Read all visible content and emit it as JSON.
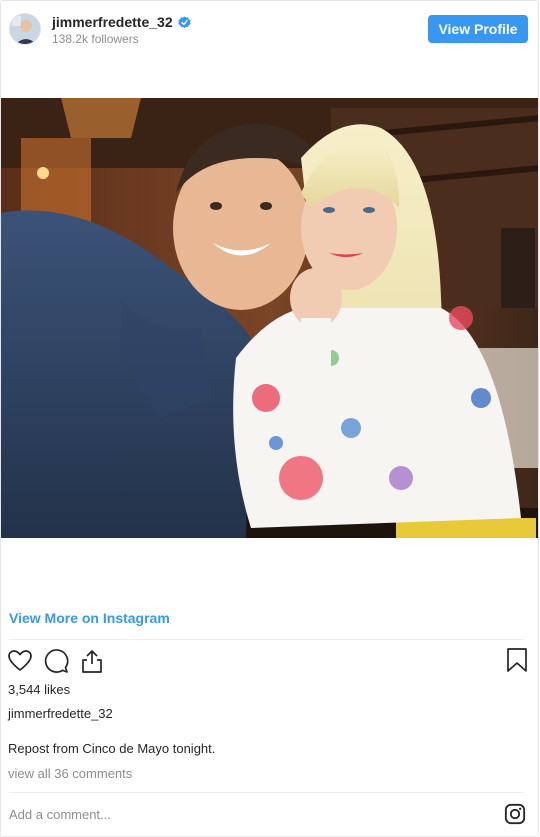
{
  "header": {
    "username": "jimmerfredette_32",
    "followers": "138.2k followers",
    "view_profile_label": "View Profile"
  },
  "post": {
    "image_alt": "Selfie of a man in a denim shirt and a blonde woman in a floral top at a restaurant",
    "view_more_label": "View More on Instagram",
    "likes": "3,544 likes",
    "caption_user": "jimmerfredette_32",
    "caption": "Repost from Cinco de Mayo tonight.",
    "view_comments": "view all 36 comments",
    "comment_placeholder": "Add a comment..."
  },
  "icons": {
    "like": "heart-icon",
    "comment": "comment-icon",
    "share": "share-icon",
    "save": "bookmark-icon",
    "verified": "verified-badge-icon",
    "brand": "instagram-logo-icon"
  },
  "colors": {
    "link": "#3897f0",
    "button": "#3897f0",
    "text": "#262626",
    "muted": "#8e8e8e",
    "border": "#efefef"
  }
}
